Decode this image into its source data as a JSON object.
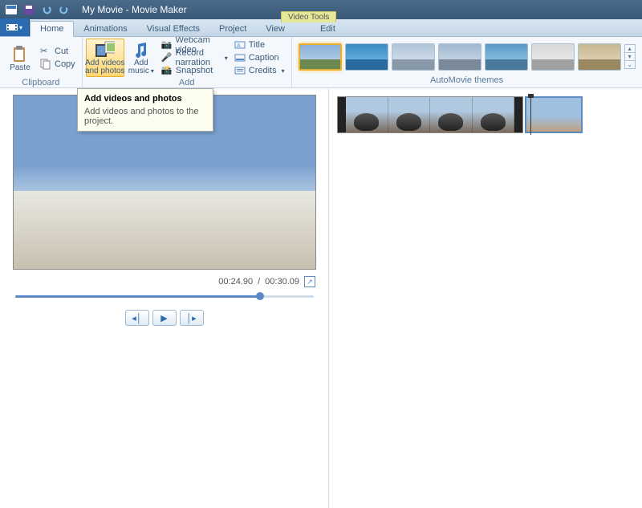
{
  "titlebar": {
    "document_name": "My Movie",
    "app_name": "Movie Maker"
  },
  "tabs": {
    "file": "",
    "home": "Home",
    "animations": "Animations",
    "visual_effects": "Visual Effects",
    "project": "Project",
    "view": "View",
    "context_group_label": "Video Tools",
    "edit": "Edit"
  },
  "ribbon": {
    "clipboard": {
      "paste": "Paste",
      "cut": "Cut",
      "copy": "Copy",
      "group_label": "Clipboard"
    },
    "add": {
      "add_videos": "Add videos\nand photos",
      "add_music": "Add\nmusic",
      "webcam_video": "Webcam video",
      "record_narration": "Record narration",
      "snapshot": "Snapshot",
      "title": "Title",
      "caption": "Caption",
      "credits": "Credits",
      "group_label": "Add"
    },
    "automovie": {
      "group_label": "AutoMovie themes"
    }
  },
  "tooltip": {
    "title": "Add videos and photos",
    "body": "Add videos and photos to the project."
  },
  "preview": {
    "position": "00:24.90",
    "duration": "00:30.09"
  }
}
